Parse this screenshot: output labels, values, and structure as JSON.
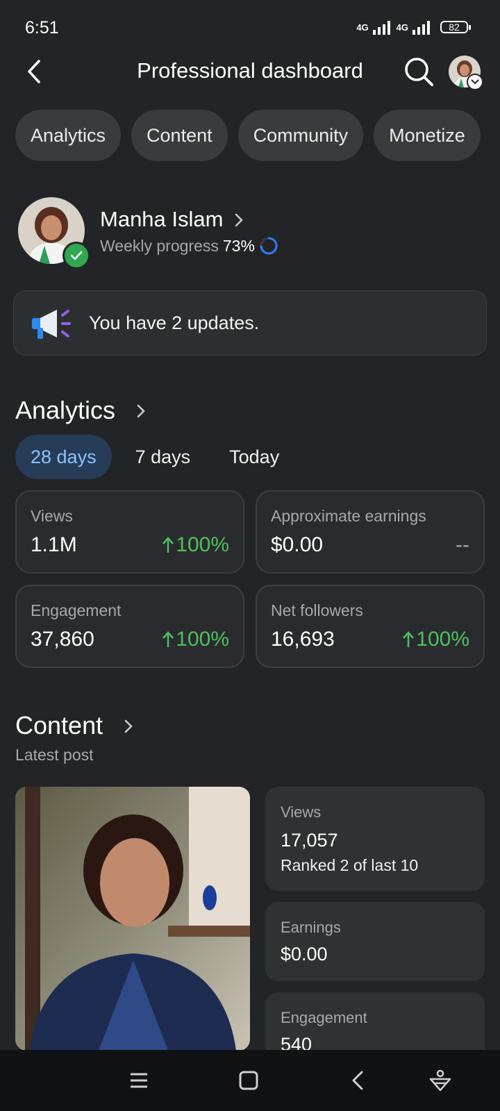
{
  "status_bar": {
    "time": "6:51",
    "network1": "4G",
    "network2": "4G",
    "battery": "82"
  },
  "header": {
    "title": "Professional dashboard"
  },
  "tabs": [
    {
      "label": "Analytics"
    },
    {
      "label": "Content"
    },
    {
      "label": "Community"
    },
    {
      "label": "Monetize"
    }
  ],
  "profile": {
    "name": "Manha Islam",
    "progress_label": "Weekly progress",
    "progress_value": "73%",
    "progress_fraction": 0.73
  },
  "updates": {
    "text": "You have 2 updates."
  },
  "analytics": {
    "title": "Analytics",
    "ranges": [
      {
        "label": "28 days"
      },
      {
        "label": "7 days"
      },
      {
        "label": "Today"
      }
    ],
    "stats": [
      {
        "label": "Views",
        "value": "1.1M",
        "change": "100%"
      },
      {
        "label": "Approximate earnings",
        "value": "$0.00",
        "change": "--"
      },
      {
        "label": "Engagement",
        "value": "37,860",
        "change": "100%"
      },
      {
        "label": "Net followers",
        "value": "16,693",
        "change": "100%"
      }
    ]
  },
  "content": {
    "title": "Content",
    "subtitle": "Latest post",
    "cards": [
      {
        "label": "Views",
        "value": "17,057",
        "note": "Ranked 2 of last 10"
      },
      {
        "label": "Earnings",
        "value": "$0.00"
      },
      {
        "label": "Engagement",
        "value": "540"
      }
    ]
  },
  "colors": {
    "background": "#232427",
    "accent_blue": "#8ec4ff",
    "positive_green": "#4cc25c",
    "verified_green": "#2fa84f"
  }
}
